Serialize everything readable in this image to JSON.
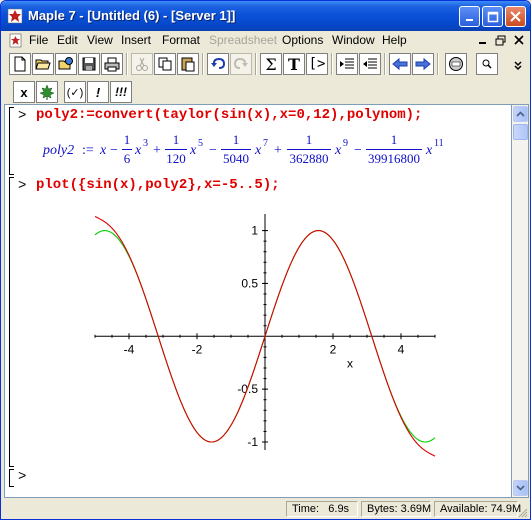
{
  "window": {
    "title": "Maple 7  - [Untitled (6) - [Server 1]]"
  },
  "menu": {
    "items": [
      "File",
      "Edit",
      "View",
      "Insert",
      "Format",
      "Spreadsheet",
      "Options",
      "Window",
      "Help"
    ],
    "disabled": [
      "Spreadsheet"
    ]
  },
  "toolbar": {
    "sigma_label": "Σ",
    "text_label": "T",
    "prompt_label": "[>"
  },
  "context_bar": {
    "x_label": "x",
    "eval_label": "(✓)",
    "bang_label": "!",
    "bang3_label": "!!!"
  },
  "worksheet": {
    "prompt_symbol": ">",
    "command1": "poly2:=convert(taylor(sin(x),x=0,12),polynom);",
    "output_lhs": "poly2",
    "output_assign": ":=",
    "output_terms": [
      {
        "sign": "",
        "coef": "",
        "power": ""
      },
      {
        "sign": "−",
        "num": "1",
        "den": "6",
        "power": "3"
      },
      {
        "sign": "+",
        "num": "1",
        "den": "120",
        "power": "5"
      },
      {
        "sign": "−",
        "num": "1",
        "den": "5040",
        "power": "7"
      },
      {
        "sign": "+",
        "num": "1",
        "den": "362880",
        "power": "9"
      },
      {
        "sign": "−",
        "num": "1",
        "den": "39916800",
        "power": "11"
      }
    ],
    "var": "x",
    "command2": "plot({sin(x),poly2},x=-5..5);"
  },
  "chart_data": {
    "type": "line",
    "title": "",
    "xlabel": "x",
    "ylabel": "",
    "xlim": [
      -5,
      5
    ],
    "ylim": [
      -1,
      1.1
    ],
    "xticks": [
      -4,
      -2,
      2,
      4
    ],
    "yticks": [
      1,
      0.5,
      -0.5,
      -1
    ],
    "xtick_labels": [
      "-4",
      "-2",
      "2",
      "4"
    ],
    "ytick_labels": [
      "1",
      "0.5",
      "-0.5",
      "-1"
    ],
    "grid": false,
    "series": [
      {
        "expression": "sin(x)",
        "color": "#00cc00",
        "samples": 60
      },
      {
        "expression": "x - x^3/6 + x^5/120 - x^7/5040 + x^9/362880 - x^11/39916800",
        "color": "#dd0000",
        "samples": 60
      }
    ]
  },
  "status": {
    "time_label": "Time:",
    "time_value": "6.9s",
    "bytes_label": "Bytes:",
    "bytes_value": "3.69M",
    "available_label": "Available:",
    "available_value": "74.9M"
  }
}
